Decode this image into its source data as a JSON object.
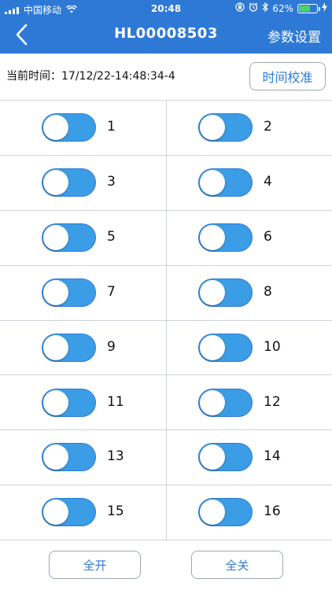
{
  "status_bar": {
    "carrier": "中国移动",
    "time": "20:48",
    "battery": "62%",
    "battery_level": 0.62,
    "icons": [
      "signal-icon",
      "wifi-icon",
      "orientation-lock-icon",
      "alarm-icon",
      "bluetooth-icon",
      "battery-icon",
      "charging-icon"
    ]
  },
  "nav": {
    "title": "HL00008503",
    "settings_label": "参数设置",
    "back_icon": "chevron-left-icon"
  },
  "timebar": {
    "label": "当前时间：17/12/22-14:48:34-4",
    "calibrate_label": "时间校准"
  },
  "switches": [
    {
      "label": "1",
      "on": true
    },
    {
      "label": "2",
      "on": true
    },
    {
      "label": "3",
      "on": true
    },
    {
      "label": "4",
      "on": true
    },
    {
      "label": "5",
      "on": true
    },
    {
      "label": "6",
      "on": true
    },
    {
      "label": "7",
      "on": true
    },
    {
      "label": "8",
      "on": true
    },
    {
      "label": "9",
      "on": true
    },
    {
      "label": "10",
      "on": true
    },
    {
      "label": "11",
      "on": true
    },
    {
      "label": "12",
      "on": true
    },
    {
      "label": "13",
      "on": true
    },
    {
      "label": "14",
      "on": true
    },
    {
      "label": "15",
      "on": true
    },
    {
      "label": "16",
      "on": true
    }
  ],
  "footer": {
    "all_on_label": "全开",
    "all_off_label": "全关"
  },
  "colors": {
    "accent": "#2f79d6",
    "toggle_on": "#3b9de6",
    "divider": "#cfd4da"
  }
}
